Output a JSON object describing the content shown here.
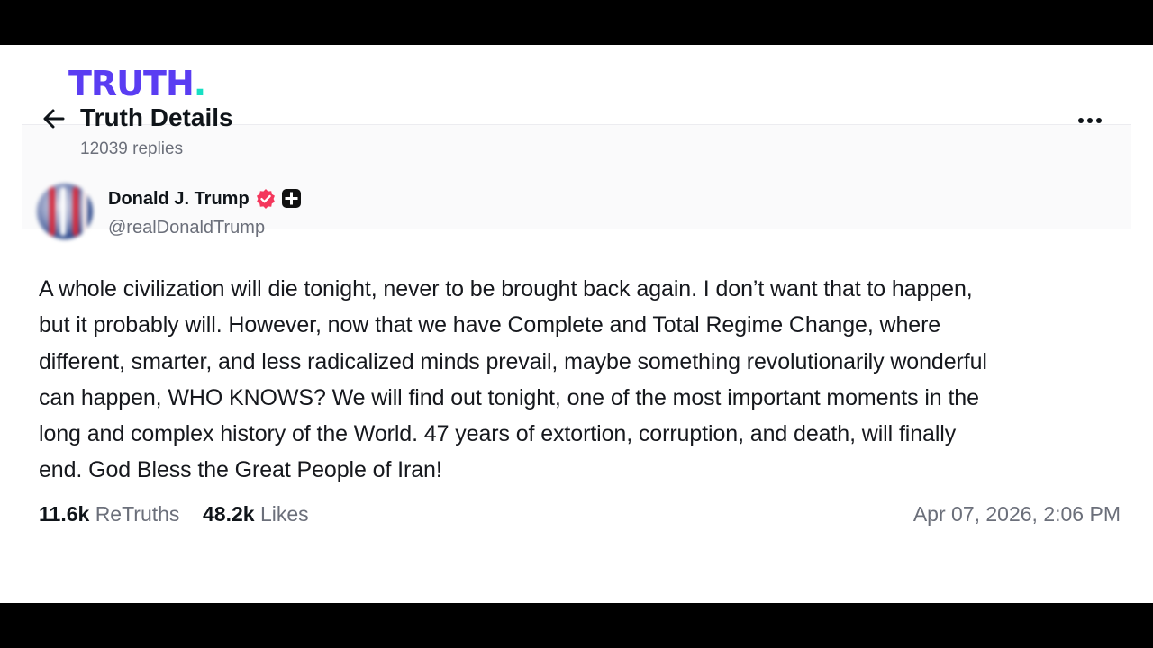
{
  "brand": {
    "logo_text": "TRUTH",
    "logo_dot": ".",
    "logo_color": "#5a3df2",
    "dot_color": "#17e0c4"
  },
  "header": {
    "title": "Truth Details",
    "replies": "12039 replies"
  },
  "author": {
    "name": "Donald J. Trump",
    "handle": "@realDonaldTrump",
    "verified_color": "#f4375c"
  },
  "post": {
    "lines": [
      "A whole civilization will die tonight, never to be brought back again. I don’t want that to happen,",
      "but it probably will. However, now that we have Complete and Total Regime Change, where",
      "different, smarter, and less radicalized minds prevail, maybe something revolutionarily wonderful",
      "can happen, WHO KNOWS? We will find out tonight, one of the most important moments in the",
      "long and complex history of the World. 47 years of extortion, corruption, and death, will finally",
      "end. God Bless the Great People of Iran!"
    ]
  },
  "stats": {
    "retruths_count": "11.6k",
    "retruths_label": "ReTruths",
    "likes_count": "48.2k",
    "likes_label": "Likes",
    "timestamp": "Apr 07, 2026, 2:06 PM"
  },
  "icons": {
    "back": "arrow-left-icon",
    "more": "ellipsis-icon",
    "verified": "verified-badge-icon",
    "plus": "plus-badge-icon"
  }
}
